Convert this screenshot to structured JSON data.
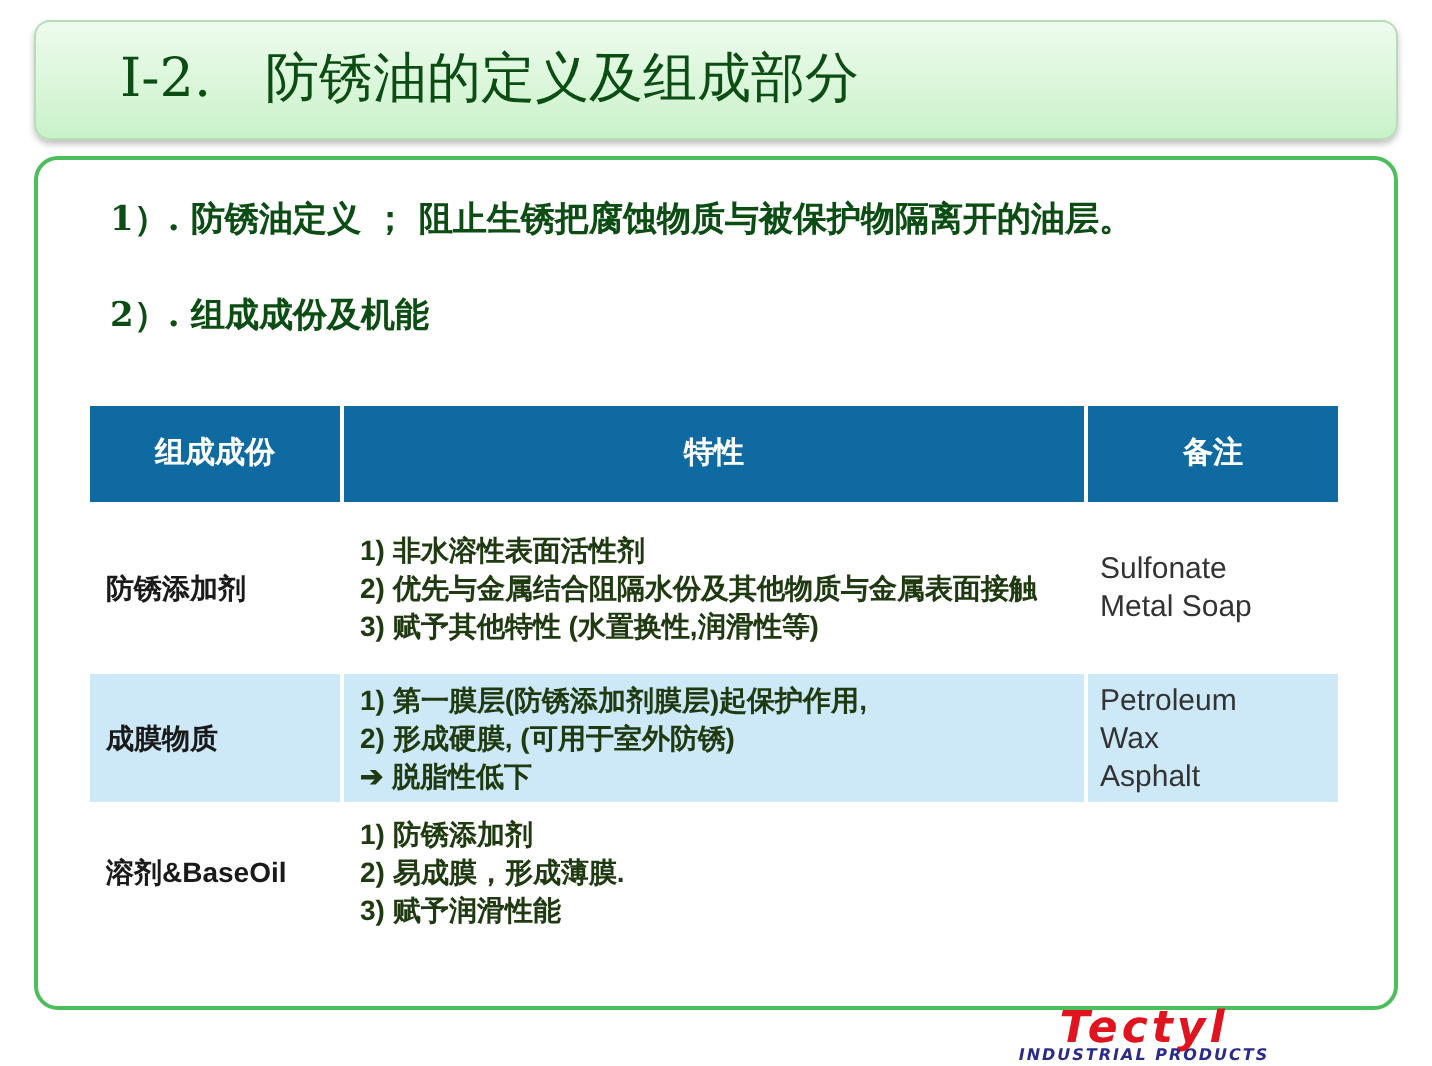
{
  "title": "Ⅰ-2.　防锈油的定义及组成部分",
  "points": [
    "1）. 防锈油定义 ； 阻止生锈把腐蚀物质与被保护物隔离开的油层。",
    "2）. 组成成份及机能"
  ],
  "table": {
    "columns": [
      "组成成份",
      "特性",
      "备注"
    ],
    "rows": [
      {
        "component": "防锈添加剂",
        "properties": [
          "1) 非水溶性表面活性剂",
          "2) 优先与金属结合阻隔水份及其他物质与金属表面接触",
          "3) 赋予其他特性 (水置换性,润滑性等)"
        ],
        "notes": [
          "Sulfonate",
          "Metal Soap"
        ]
      },
      {
        "component": "成膜物质",
        "properties": [
          "1) 第一膜层(防锈添加剂膜层)起保护作用,",
          "2) 形成硬膜, (可用于室外防锈)",
          "➔ 脱脂性低下"
        ],
        "notes": [
          "Petroleum",
          "Wax",
          "Asphalt"
        ]
      },
      {
        "component": "溶剂&BaseOil",
        "properties": [
          "1) 防锈添加剂",
          "2) 易成膜，形成薄膜.",
          "3) 赋予润滑性能"
        ],
        "notes": []
      }
    ]
  },
  "logo": {
    "name": "Tectyl",
    "tagline": "INDUSTRIAL PRODUCTS"
  }
}
